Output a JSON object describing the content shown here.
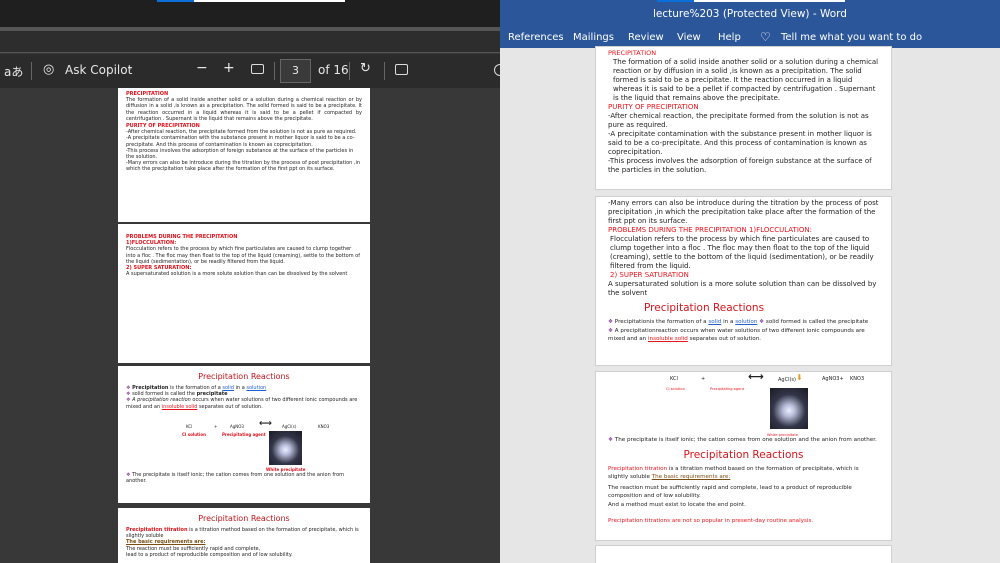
{
  "pdf_viewer": {
    "toolbar": {
      "read_aloud_icon": "aあ",
      "copilot_label": "Ask Copilot",
      "zoom_out": "−",
      "zoom_in": "+",
      "current_page": "3",
      "page_total": "of 16"
    },
    "pages": [
      {
        "heading": "PRECIPITATION",
        "para": "The formation of a solid inside another solid or a solution during a chemical reaction or by diffusion in a solid ,is known as a precipitation. The solid formed is said to be a precipitate. It the reaction occurred in a liquid whereas it is said to be a pellet if compacted by centrifugation . Supernant is the liquid that remains above the precipitate.",
        "purity_heading": "PURITY OF PRECIPITATION",
        "p1": "-After chemical reaction, the precipitate formed from the solution is not as pure as required.",
        "p2": "-A precipitate contamination with the substance present in mother liquor is said to be a co-precipitate. And this process of contamination is known as coprecipitation.",
        "p3": "-This process involves the adsorption of foreign substance at the surface of the particles in the solution.",
        "p4": "-Many errors can also be introduce during the titration by the process of post precipitation ,in which the precipitation take place after the formation of the first ppt on its surface."
      },
      {
        "heading": "PROBLEMS DURING THE PRECIPITATION",
        "sub1": "1)FLOCCULATION:",
        "para1": "Flocculation refers to the process by which fine particulates are caused to clump together into a floc . The floc may then float to the top of the liquid (creaming), settle to the bottom of the liquid (sedimentation), or be readily filtered from the liquid.",
        "sub2": "2) SUPER SATURATION:",
        "para2": "A supersaturated solution is a more solute solution than can be dissolved by the solvent"
      },
      {
        "title": "Precipitation Reactions",
        "b1a": "Precipitation",
        "b1b": " is the formation of a ",
        "b1c": "solid",
        "b1d": " in a ",
        "b1e": "solution",
        "b2a": "solid formed is called the ",
        "b2b": "precipitate",
        "b3a": "A precipitation reaction",
        "b3b": " occurs when water solutions of two different ionic compounds are mixed and an ",
        "b3c": "insoluble solid",
        "b3d": " separates out of solution.",
        "eq_kcl": "KCl",
        "eq_plus": "+",
        "eq_agno3": "AgNO3",
        "eq_agcl": "AgCl(s)",
        "eq_kno3": "KNO3",
        "lbl_solution": "Cl solution",
        "lbl_agent": "Precipitating agent",
        "lbl_white": "White precipitate",
        "b4": "The precipitate is itself ionic; the cation comes from one solution and the anion from another."
      },
      {
        "title": "Precipitation Reactions",
        "l1a": "Precipitation titration",
        "l1b": " is a titration method based on the formation of precipitate, which is slightly soluble",
        "l2": "The basic requirements are:",
        "l3": "The reaction must be sufficiently rapid and complete,",
        "l4": "lead to a product of reproducible composition and of low solubility."
      }
    ]
  },
  "word": {
    "title": "lecture%203 (Protected View)  -  Word",
    "tabs": [
      "References",
      "Mailings",
      "Review",
      "View",
      "Help"
    ],
    "tell_me": "Tell me what you want to do",
    "page1": {
      "heading": "PRECIPITATION",
      "para": "The formation of a solid inside another solid or a solution during a chemical reaction or by diffusion in a solid ,is known as a precipitation. The solid formed is said to be a precipitate. It the reaction occurred in a liquid whereas it is said to be a pellet if compacted by centrifugation . Supernant is the liquid that remains above the precipitate.",
      "purity_heading": "PURITY OF PRECIPITATION",
      "p1": "-After chemical reaction, the precipitate formed from the solution is not as pure as required.",
      "p2": "-A precipitate contamination with the substance present in mother liquor is said to be a co-precipitate. And this process of contamination is known as coprecipitation.",
      "p3": "-This process involves the adsorption of foreign substance at the surface of the particles in the solution."
    },
    "page2": {
      "p4": "-Many errors can also be introduce during the titration by the process of post precipitation ,in which the precipitation take place after the formation of the first ppt on its surface.",
      "heading": "PROBLEMS DURING THE PRECIPITATION 1)FLOCCULATION:",
      "para1": "Flocculation refers to the process by which fine particulates are caused to clump together into a floc . The floc may then float to the top of the liquid (creaming), settle to the bottom of the liquid (sedimentation), or be readily filtered from the liquid.",
      "sub2": "2) SUPER SATURATION",
      "para2": "A supersaturated solution is a more solute solution than can be dissolved by the solvent",
      "title": "Precipitation Reactions",
      "b1a": "Precipitationis the formation of a ",
      "b1b": "solid",
      "b1c": " in a ",
      "b1d": "solution",
      "b1e": "solid formed is called the precipitate",
      "b2a": "A precipitationreaction occurs when water solutions of two different ionic compounds are mixed and an ",
      "b2b": "insoluble solid",
      "b2c": " separates out of solution."
    },
    "page3": {
      "eq_kcl": "KCl",
      "eq_plus": "+",
      "eq_agcl": "AgCl(s)",
      "eq_agno3": "AgNO3+",
      "eq_kno3": "KNO3",
      "lbl_solution": "Cl solution",
      "lbl_agent": "Precipitating agent",
      "lbl_white": "White precipitate",
      "b4": "The precipitate is itself ionic; the cation comes from one solution and the anion from another.",
      "title": "Precipitation Reactions",
      "t1a": "Precipitation titration",
      "t1b": " is a titration method based on the formation of precipitate, which is slightly soluble ",
      "t1c": "The basic requirements are:",
      "t2": "The reaction must be sufficiently rapid and complete, lead to a product of reproducible composition and of low solubility.",
      "t3": "And a method must exist to locate the end point.",
      "t4": "Precipitation titrations are not so popular in present-day routine analysis."
    }
  }
}
